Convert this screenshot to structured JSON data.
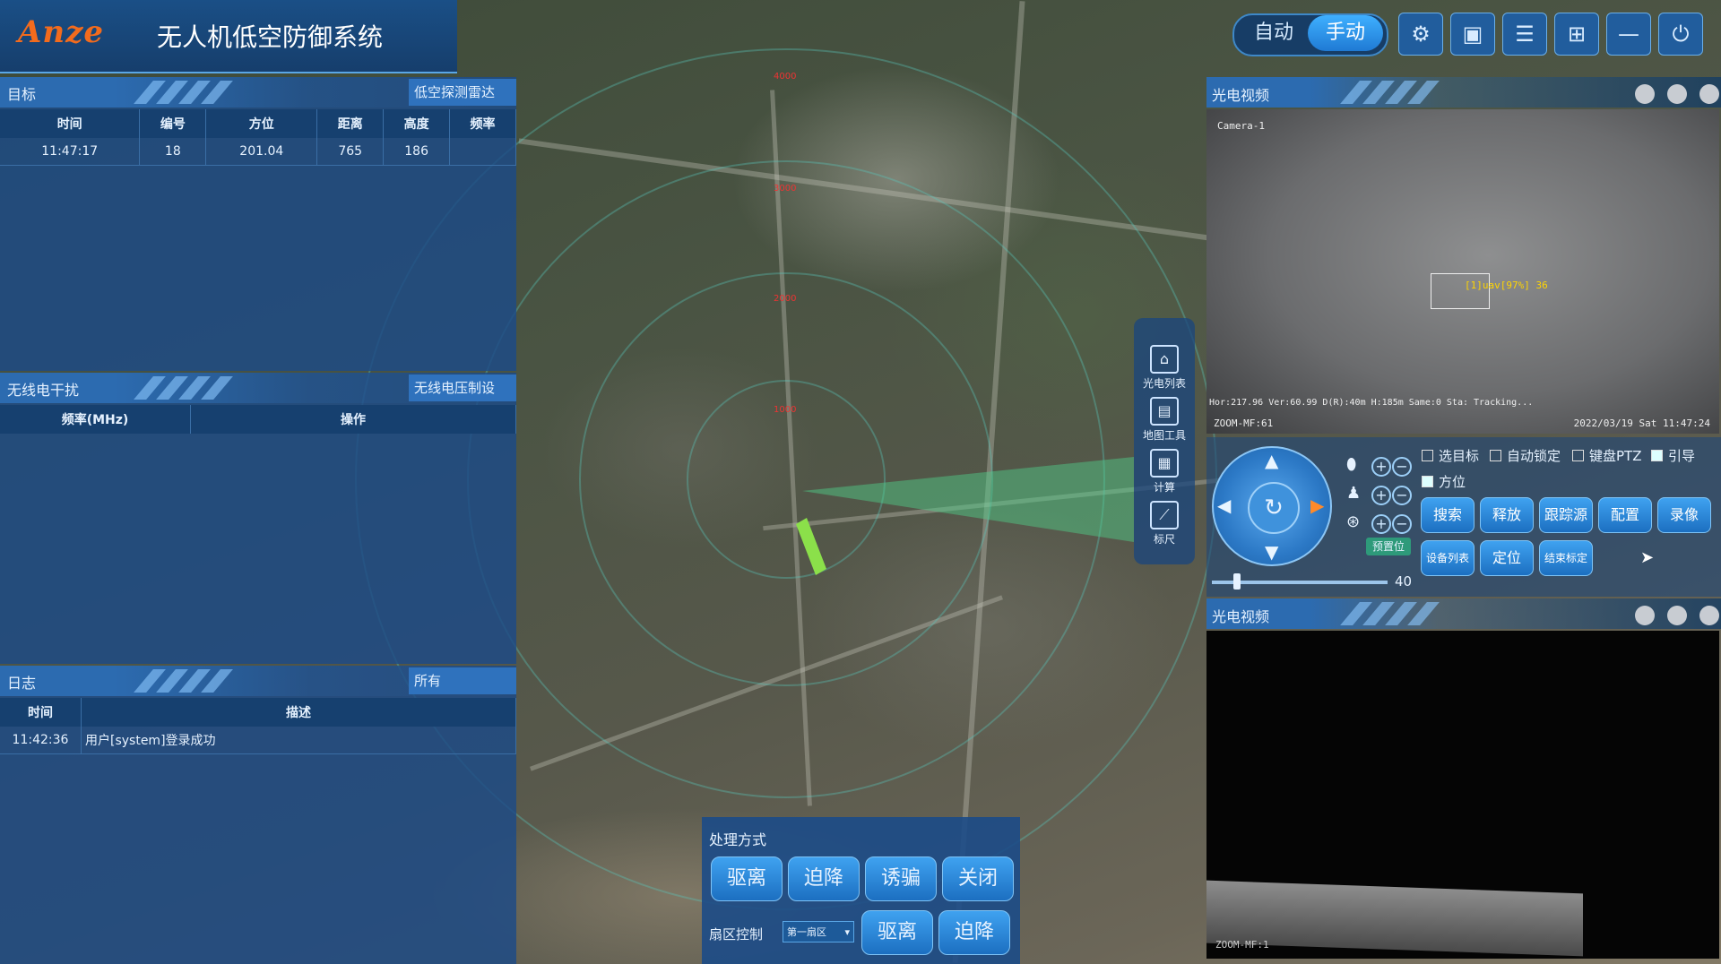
{
  "header": {
    "logo": "Anze",
    "title": "无人机低空防御系统"
  },
  "modes": {
    "auto": "自动",
    "manual": "手动"
  },
  "toolbar_icons": [
    "gear-icon",
    "monitor-icon",
    "list-icon",
    "layout-icon",
    "minimize-icon",
    "power-icon"
  ],
  "targets": {
    "title": "目标",
    "source": "低空探测雷达",
    "columns": [
      "时间",
      "编号",
      "方位",
      "距离",
      "高度",
      "频率"
    ],
    "rows": [
      [
        "11:47:17",
        "18",
        "201.04",
        "765",
        "186",
        ""
      ]
    ]
  },
  "jamming": {
    "title": "无线电干扰",
    "device": "无线电压制设",
    "columns": [
      "频率(MHz)",
      "操作"
    ]
  },
  "log": {
    "title": "日志",
    "filter": "所有",
    "columns": [
      "时间",
      "描述"
    ],
    "rows": [
      [
        "11:42:36",
        "用户[system]登录成功"
      ]
    ]
  },
  "map": {
    "range_labels": [
      "4000",
      "3000",
      "2000",
      "1000"
    ],
    "tools": [
      "光电列表",
      "地图工具",
      "计算",
      "标尺"
    ]
  },
  "video1": {
    "title": "光电视频",
    "camera": "Camera-1",
    "target_label": "[1]uav[97%] 36",
    "status": "Hor:217.96 Ver:60.99 D(R):40m H:185m Same:0 Sta: Tracking...",
    "zoom": "ZOOM-MF:61",
    "datetime": "2022/03/19 Sat 11:47:24"
  },
  "ptz": {
    "preset": "预置位",
    "slider_value": "40",
    "checkboxes": [
      {
        "label": "选目标",
        "checked": false
      },
      {
        "label": "自动锁定",
        "checked": false
      },
      {
        "label": "键盘PTZ",
        "checked": false
      },
      {
        "label": "引导",
        "checked": true
      },
      {
        "label": "方位",
        "checked": true
      }
    ],
    "buttons_row1": [
      "搜索",
      "释放",
      "跟踪源",
      "配置",
      "录像"
    ],
    "buttons_row2": [
      "设备列表",
      "定位",
      "结束标定"
    ]
  },
  "video2": {
    "title": "光电视频",
    "zoom": "ZOOM-MF:1"
  },
  "processing": {
    "title": "处理方式",
    "buttons": [
      "驱离",
      "迫降",
      "诱骗",
      "关闭"
    ],
    "sector_label": "扇区控制",
    "sector_value": "第一扇区",
    "sector_buttons": [
      "驱离",
      "迫降"
    ]
  }
}
